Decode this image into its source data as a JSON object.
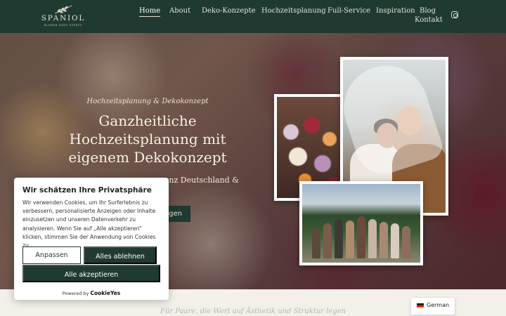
{
  "logo": {
    "name": "SPANIOL",
    "tagline": "BLUMEN DEKO EVENTS"
  },
  "nav": {
    "items": [
      {
        "label": "Home"
      },
      {
        "label": "About"
      },
      {
        "label": "Deko-Konzepte"
      },
      {
        "label": "Hochzeitsplanung"
      },
      {
        "label": "Full-Service"
      },
      {
        "label": "Inspiration"
      },
      {
        "label": "Blog"
      },
      {
        "label": "Kontakt"
      }
    ],
    "active_index": 0,
    "social_icon": "instagram-icon"
  },
  "hero": {
    "eyebrow": "Hochzeitsplanung & Dekokonzept",
    "title": "Ganzheitliche Hochzeitsplanung mit eigenem Dekokonzept",
    "subtitle": "nz Deutschland &",
    "cta_label": "agen"
  },
  "cookie": {
    "title": "Wir schätzen Ihre Privatsphäre",
    "text": "Wir verwenden Cookies, um Ihr Surferlebnis zu verbessern, personalisierte Anzeigen oder Inhalte einzusetzen und unseren Datenverkehr zu analysieren. Wenn Sie auf „Alle akzeptieren“ klicken, stimmen Sie der Anwendung von Cookies zu.",
    "customize_label": "Anpassen",
    "reject_label": "Alles ablehnen",
    "accept_label": "Alle akzeptieren",
    "powered_by": "Powered by",
    "powered_brand": "CookieYes"
  },
  "tagline": "Für Paare, die Wert auf Ästhetik und Struktur legen",
  "language": {
    "label": "German",
    "flag_icon": "germany-flag-icon"
  },
  "colors": {
    "brand_green": "#1f3a31",
    "header_text": "#e6e1d6"
  }
}
